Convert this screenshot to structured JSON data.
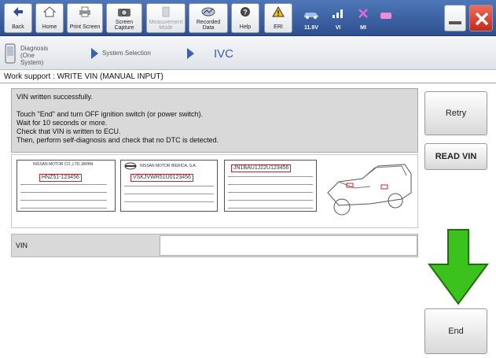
{
  "toolbar": {
    "buttons": [
      {
        "label": "Back",
        "icon": "back-arrow-icon"
      },
      {
        "label": "Home",
        "icon": "home-icon"
      },
      {
        "label": "Print Screen",
        "icon": "printer-icon"
      },
      {
        "label": "Screen Capture",
        "icon": "camera-icon"
      },
      {
        "label": "Measurement Mode",
        "icon": "measurement-icon"
      },
      {
        "label": "Recorded Data",
        "icon": "recorded-data-icon"
      },
      {
        "label": "Help",
        "icon": "help-icon"
      },
      {
        "label": "ERI",
        "icon": "warning-icon"
      }
    ],
    "status": {
      "battery_voltage": "11.9V",
      "vi_label": "VI",
      "mi_label": "MI"
    }
  },
  "breadcrumb": {
    "items": [
      "Diagnosis (One System)",
      "System Selection"
    ],
    "current": "IVC"
  },
  "page": {
    "title": "Work support : WRITE VIN (MANUAL INPUT)"
  },
  "message": {
    "lines": [
      "VIN written successfully.",
      "Touch \"End\" and turn OFF ignition switch (or power switch).",
      "Wait for 10 seconds or more.",
      "Check that VIN is written to ECU.",
      "Then, perform self-diagnosis and check that no DTC is detected."
    ]
  },
  "side_buttons": {
    "retry": "Retry",
    "read_vin": "READ VIN",
    "end": "End"
  },
  "plates": {
    "plate1_header": "NISSAN MOTOR CO.,LTD.JAPAN",
    "plate1_vin": "HNZ51-123456",
    "plate2_header": "NISSAN MOTOR IBERICA, S.A.",
    "plate2_vin": "VSKJVWR51U0123456",
    "plate3_vin": "JN1BAU1J22U123456"
  },
  "vin_field": {
    "label": "VIN",
    "value": ""
  },
  "colors": {
    "toolbar": "#3a62a8",
    "highlight": "#d0202a",
    "arrow": "#3cc21c"
  }
}
